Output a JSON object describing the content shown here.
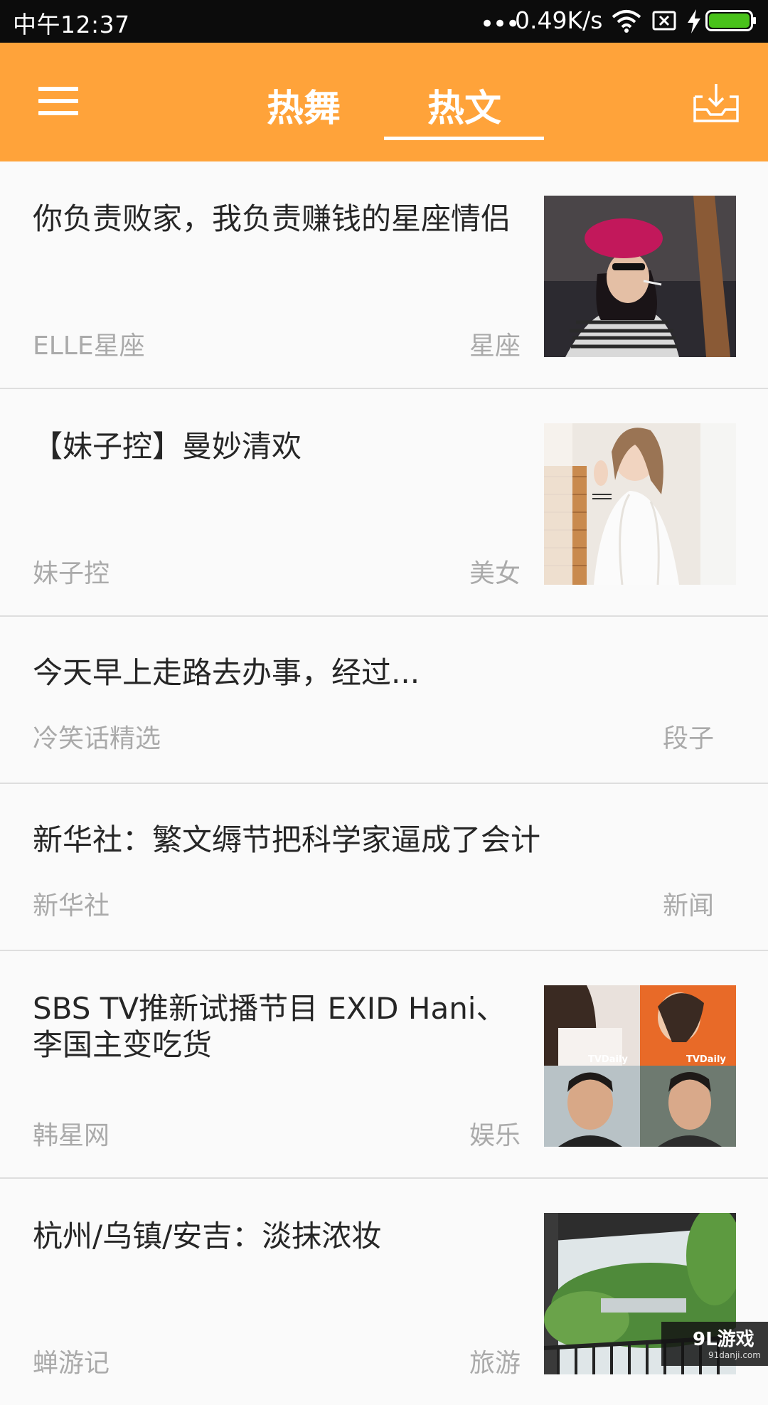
{
  "status_bar": {
    "time": "中午12:37",
    "dots": "•••",
    "network_speed": "0.49K/s",
    "icons": [
      "wifi-icon",
      "sim-off-icon",
      "charging-bolt-icon",
      "battery-icon"
    ],
    "battery_color": "#49c21a"
  },
  "app_bar": {
    "background": "#ffa33a",
    "tabs": [
      {
        "label": "热舞",
        "selected": false
      },
      {
        "label": "热文",
        "selected": true
      }
    ],
    "icons": [
      "menu-icon",
      "download-tray-icon"
    ]
  },
  "feed": [
    {
      "title": "你负责败家，我负责赚钱的星座情侣",
      "source": "ELLE星座",
      "category": "星座",
      "has_image": true,
      "image": "woman-red-beret-photo"
    },
    {
      "title": "【妹子控】曼妙清欢",
      "source": "妹子控",
      "category": "美女",
      "has_image": true,
      "image": "girl-white-lace-photo"
    },
    {
      "title": "今天早上走路去办事，经过...",
      "source": "冷笑话精选",
      "category": "段子",
      "has_image": false
    },
    {
      "title": "新华社：繁文缛节把科学家逼成了会计",
      "source": "新华社",
      "category": "新闻",
      "has_image": false
    },
    {
      "title": "SBS TV推新试播节目 EXID Hani、李国主变吃货",
      "source": "韩星网",
      "category": "娱乐",
      "has_image": true,
      "image": "tv-show-collage-photo",
      "collage_labels": [
        "TVDaily",
        "TVDaily"
      ]
    },
    {
      "title": "杭州/乌镇/安吉：淡抹浓妆",
      "source": "蝉游记",
      "category": "旅游",
      "has_image": true,
      "image": "balcony-trees-photo"
    }
  ],
  "watermark": {
    "logo": "9L游戏",
    "url": "91danji.com"
  }
}
